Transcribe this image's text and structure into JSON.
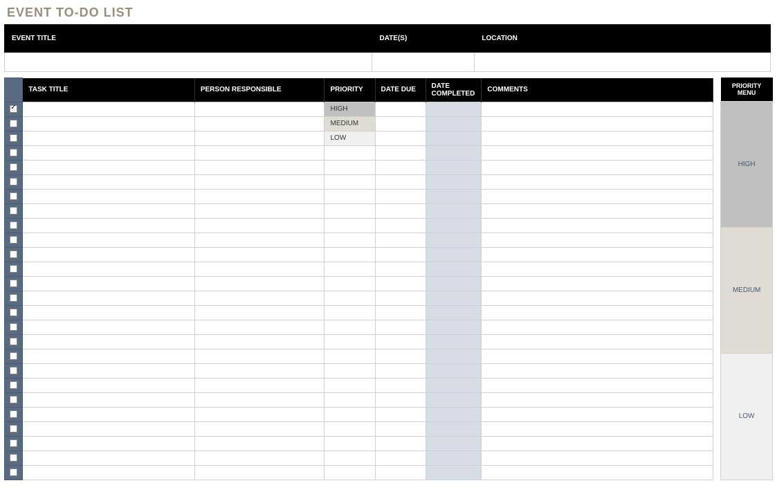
{
  "page_title": "EVENT TO-DO LIST",
  "top_headers": {
    "event_title": "EVENT TITLE",
    "dates": "DATE(S)",
    "location": "LOCATION"
  },
  "top_values": {
    "event_title": "",
    "dates": "",
    "location": ""
  },
  "task_headers": {
    "check": "",
    "task_title": "TASK TITLE",
    "person": "PERSON RESPONSIBLE",
    "priority": "PRIORITY",
    "date_due": "DATE DUE",
    "date_completed": "DATE COMPLETED",
    "comments": "COMMENTS"
  },
  "rows": [
    {
      "checked": true,
      "task": "",
      "person": "",
      "priority": "HIGH",
      "due": "",
      "done": "",
      "comments": ""
    },
    {
      "checked": false,
      "task": "",
      "person": "",
      "priority": "MEDIUM",
      "due": "",
      "done": "",
      "comments": ""
    },
    {
      "checked": false,
      "task": "",
      "person": "",
      "priority": "LOW",
      "due": "",
      "done": "",
      "comments": ""
    },
    {
      "checked": false,
      "task": "",
      "person": "",
      "priority": "",
      "due": "",
      "done": "",
      "comments": ""
    },
    {
      "checked": false,
      "task": "",
      "person": "",
      "priority": "",
      "due": "",
      "done": "",
      "comments": ""
    },
    {
      "checked": false,
      "task": "",
      "person": "",
      "priority": "",
      "due": "",
      "done": "",
      "comments": ""
    },
    {
      "checked": false,
      "task": "",
      "person": "",
      "priority": "",
      "due": "",
      "done": "",
      "comments": ""
    },
    {
      "checked": false,
      "task": "",
      "person": "",
      "priority": "",
      "due": "",
      "done": "",
      "comments": ""
    },
    {
      "checked": false,
      "task": "",
      "person": "",
      "priority": "",
      "due": "",
      "done": "",
      "comments": ""
    },
    {
      "checked": false,
      "task": "",
      "person": "",
      "priority": "",
      "due": "",
      "done": "",
      "comments": ""
    },
    {
      "checked": false,
      "task": "",
      "person": "",
      "priority": "",
      "due": "",
      "done": "",
      "comments": ""
    },
    {
      "checked": false,
      "task": "",
      "person": "",
      "priority": "",
      "due": "",
      "done": "",
      "comments": ""
    },
    {
      "checked": false,
      "task": "",
      "person": "",
      "priority": "",
      "due": "",
      "done": "",
      "comments": ""
    },
    {
      "checked": false,
      "task": "",
      "person": "",
      "priority": "",
      "due": "",
      "done": "",
      "comments": ""
    },
    {
      "checked": false,
      "task": "",
      "person": "",
      "priority": "",
      "due": "",
      "done": "",
      "comments": ""
    },
    {
      "checked": false,
      "task": "",
      "person": "",
      "priority": "",
      "due": "",
      "done": "",
      "comments": ""
    },
    {
      "checked": false,
      "task": "",
      "person": "",
      "priority": "",
      "due": "",
      "done": "",
      "comments": ""
    },
    {
      "checked": false,
      "task": "",
      "person": "",
      "priority": "",
      "due": "",
      "done": "",
      "comments": ""
    },
    {
      "checked": false,
      "task": "",
      "person": "",
      "priority": "",
      "due": "",
      "done": "",
      "comments": ""
    },
    {
      "checked": false,
      "task": "",
      "person": "",
      "priority": "",
      "due": "",
      "done": "",
      "comments": ""
    },
    {
      "checked": false,
      "task": "",
      "person": "",
      "priority": "",
      "due": "",
      "done": "",
      "comments": ""
    },
    {
      "checked": false,
      "task": "",
      "person": "",
      "priority": "",
      "due": "",
      "done": "",
      "comments": ""
    },
    {
      "checked": false,
      "task": "",
      "person": "",
      "priority": "",
      "due": "",
      "done": "",
      "comments": ""
    },
    {
      "checked": false,
      "task": "",
      "person": "",
      "priority": "",
      "due": "",
      "done": "",
      "comments": ""
    },
    {
      "checked": false,
      "task": "",
      "person": "",
      "priority": "",
      "due": "",
      "done": "",
      "comments": ""
    },
    {
      "checked": false,
      "task": "",
      "person": "",
      "priority": "",
      "due": "",
      "done": "",
      "comments": ""
    }
  ],
  "priority_menu": {
    "header": "PRIORITY MENU",
    "options": [
      "HIGH",
      "MEDIUM",
      "LOW"
    ]
  }
}
